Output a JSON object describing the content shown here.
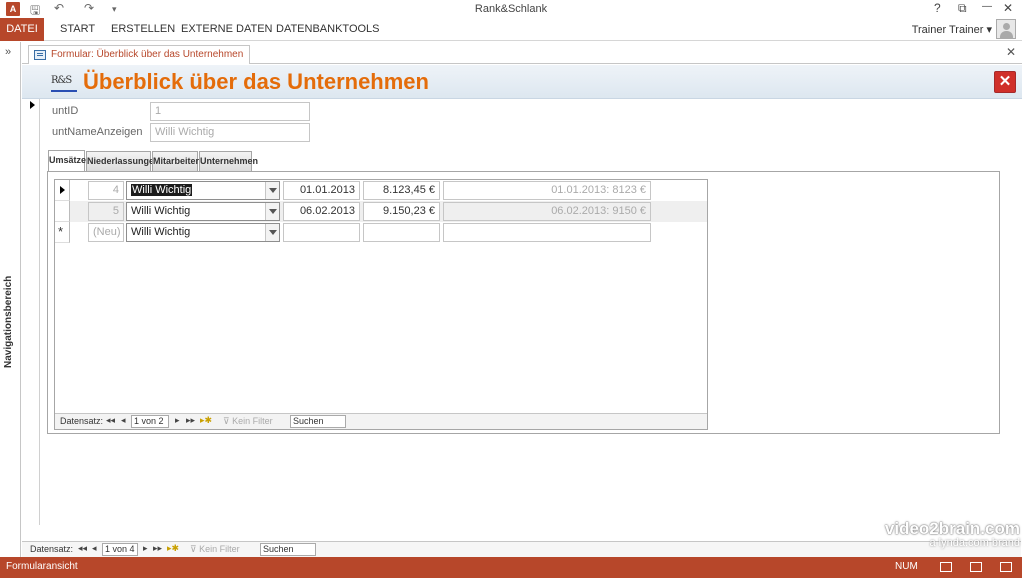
{
  "window": {
    "title": "Rank&Schlank",
    "controls": {
      "help": "?",
      "restore": "⧉",
      "minimize": "—",
      "maximize": "❐",
      "close": "✕"
    }
  },
  "ribbon": {
    "tabs": [
      "DATEI",
      "START",
      "ERSTELLEN",
      "EXTERNE DATEN",
      "DATENBANKTOOLS"
    ],
    "user": "Trainer Trainer ▾"
  },
  "navpane": {
    "label": "Navigationsbereich",
    "toggle": "»"
  },
  "doc_tab": {
    "label": "Formular: Überblick über das Unternehmen",
    "close": "✕"
  },
  "form": {
    "title": "Überblick über das Unternehmen",
    "logo_text": "R&S",
    "close_button": "✕",
    "fields": [
      {
        "label": "untID",
        "value": "1"
      },
      {
        "label": "untNameAnzeigen",
        "value": "Willi Wichtig"
      }
    ],
    "tabs": [
      "Umsätze",
      "Niederlassungen",
      "Mitarbeiter",
      "Unternehmen"
    ],
    "active_tab": "Umsätze"
  },
  "subform": {
    "rows": [
      {
        "id": "4",
        "name": "Willi Wichtig",
        "date": "01.01.2013",
        "amount": "8.123,45 €",
        "summary": "01.01.2013: 8123 €",
        "selector": "current"
      },
      {
        "id": "5",
        "name": "Willi Wichtig",
        "date": "06.02.2013",
        "amount": "9.150,23 €",
        "summary": "06.02.2013: 9150 €",
        "selector": "none"
      },
      {
        "id": "(Neu)",
        "name": "Willi Wichtig",
        "date": "",
        "amount": "",
        "summary": "",
        "selector": "new"
      }
    ],
    "nav": {
      "label": "Datensatz:",
      "first": "◂◂",
      "prev": "◂",
      "position": "1 von 2",
      "next": "▸",
      "last": "▸▸",
      "new": "▸✱",
      "filter": "Kein Filter",
      "search": "Suchen"
    }
  },
  "main_nav": {
    "label": "Datensatz:",
    "position": "1 von 4",
    "filter": "Kein Filter",
    "search": "Suchen"
  },
  "statusbar": {
    "mode": "Formularansicht",
    "num": "NUM"
  },
  "watermark": {
    "line1": "video2brain.com",
    "line2": "a lynda.com brand"
  }
}
